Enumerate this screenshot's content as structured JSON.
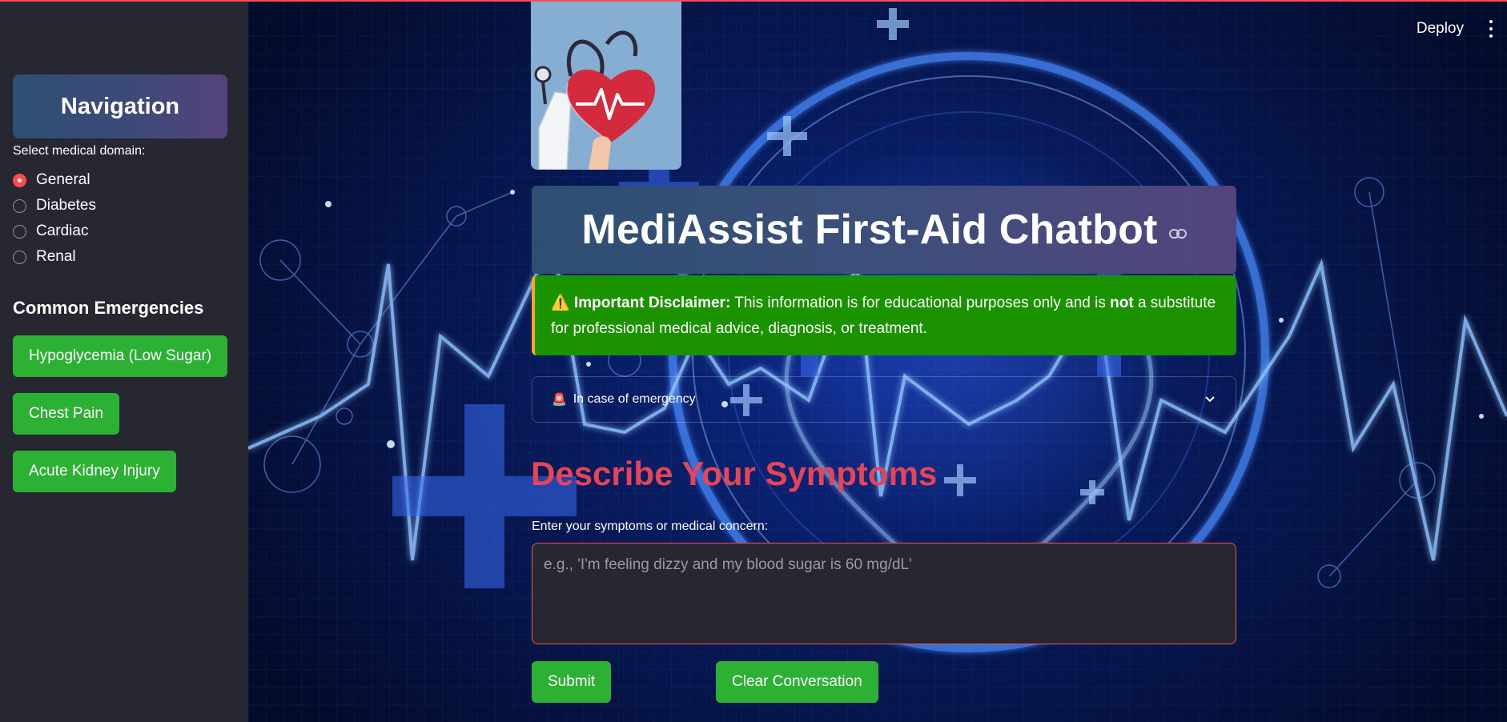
{
  "sidebar": {
    "nav_title": "Navigation",
    "domain_label": "Select medical domain:",
    "domains": [
      "General",
      "Diabetes",
      "Cardiac",
      "Renal"
    ],
    "selected_domain": "General",
    "emergencies_heading": "Common Emergencies",
    "emergency_buttons": [
      "Hypoglycemia (Low Sugar)",
      "Chest Pain",
      "Acute Kidney Injury"
    ]
  },
  "header": {
    "deploy_label": "Deploy",
    "menu_icon": "vertical-dots-icon"
  },
  "main": {
    "title": "MediAssist First-Aid Chatbot",
    "disclaimer": {
      "icon": "⚠️",
      "bold": "Important Disclaimer:",
      "text_before": " This information is for educational purposes only and is ",
      "not_word": "not",
      "text_after": " a substitute for professional medical advice, diagnosis, or treatment."
    },
    "expander": {
      "icon": "🚨",
      "label": "In case of emergency"
    },
    "symptoms_heading": "Describe Your Symptoms",
    "symptoms_label": "Enter your symptoms or medical concern:",
    "symptoms_placeholder": "e.g., 'I'm feeling dizzy and my blood sugar is 60 mg/dL'",
    "submit_label": "Submit",
    "clear_label": "Clear Conversation"
  },
  "colors": {
    "accent": "#ff4b4b",
    "sidebar_bg": "#262730",
    "green_button": "#2db135",
    "disclaimer_bg": "#1b9200",
    "heading_red": "#e84356"
  }
}
